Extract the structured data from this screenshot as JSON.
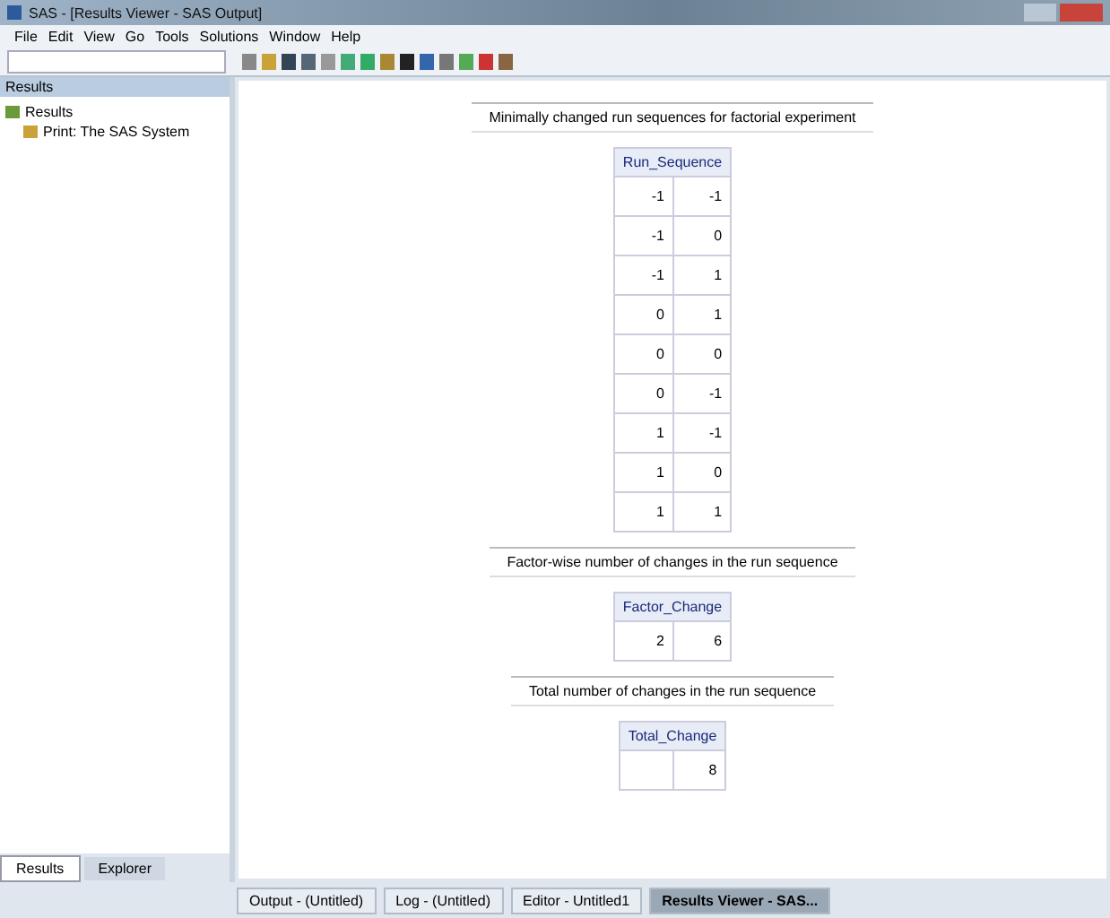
{
  "window": {
    "title": "SAS - [Results Viewer - SAS Output]"
  },
  "menu": [
    "File",
    "Edit",
    "View",
    "Go",
    "Tools",
    "Solutions",
    "Window",
    "Help"
  ],
  "sidebar": {
    "title": "Results",
    "tree": [
      {
        "label": "Results",
        "expanded": true,
        "children": [
          {
            "label": "Print: The SAS System",
            "expanded": false
          }
        ]
      }
    ],
    "tabs": [
      {
        "label": "Results",
        "selected": true
      },
      {
        "label": "Explorer",
        "selected": false
      }
    ]
  },
  "sections": [
    {
      "title": "Minimally changed run sequences for factorial experiment",
      "table": {
        "columns": [
          {
            "label": "Run_Sequence",
            "colspan": 2
          }
        ],
        "rows": [
          [
            "-1",
            "-1"
          ],
          [
            "-1",
            "0"
          ],
          [
            "-1",
            "1"
          ],
          [
            "0",
            "1"
          ],
          [
            "0",
            "0"
          ],
          [
            "0",
            "-1"
          ],
          [
            "1",
            "-1"
          ],
          [
            "1",
            "0"
          ],
          [
            "1",
            "1"
          ]
        ]
      }
    },
    {
      "title": "Factor-wise number of changes in the run sequence",
      "table": {
        "columns": [
          {
            "label": "Factor_Change",
            "colspan": 2
          }
        ],
        "rows": [
          [
            "2",
            "6"
          ]
        ]
      }
    },
    {
      "title": "Total number of changes in the run sequence",
      "table": {
        "columns": [
          {
            "label": "Total_Change",
            "colspan": 2
          }
        ],
        "rows": [
          [
            "",
            "8"
          ]
        ]
      }
    }
  ],
  "taskbar": [
    {
      "label": "Output - (Untitled)",
      "selected": false
    },
    {
      "label": "Log - (Untitled)",
      "selected": false
    },
    {
      "label": "Editor - Untitled1",
      "selected": false
    },
    {
      "label": "Results Viewer - SAS...",
      "selected": true
    }
  ]
}
